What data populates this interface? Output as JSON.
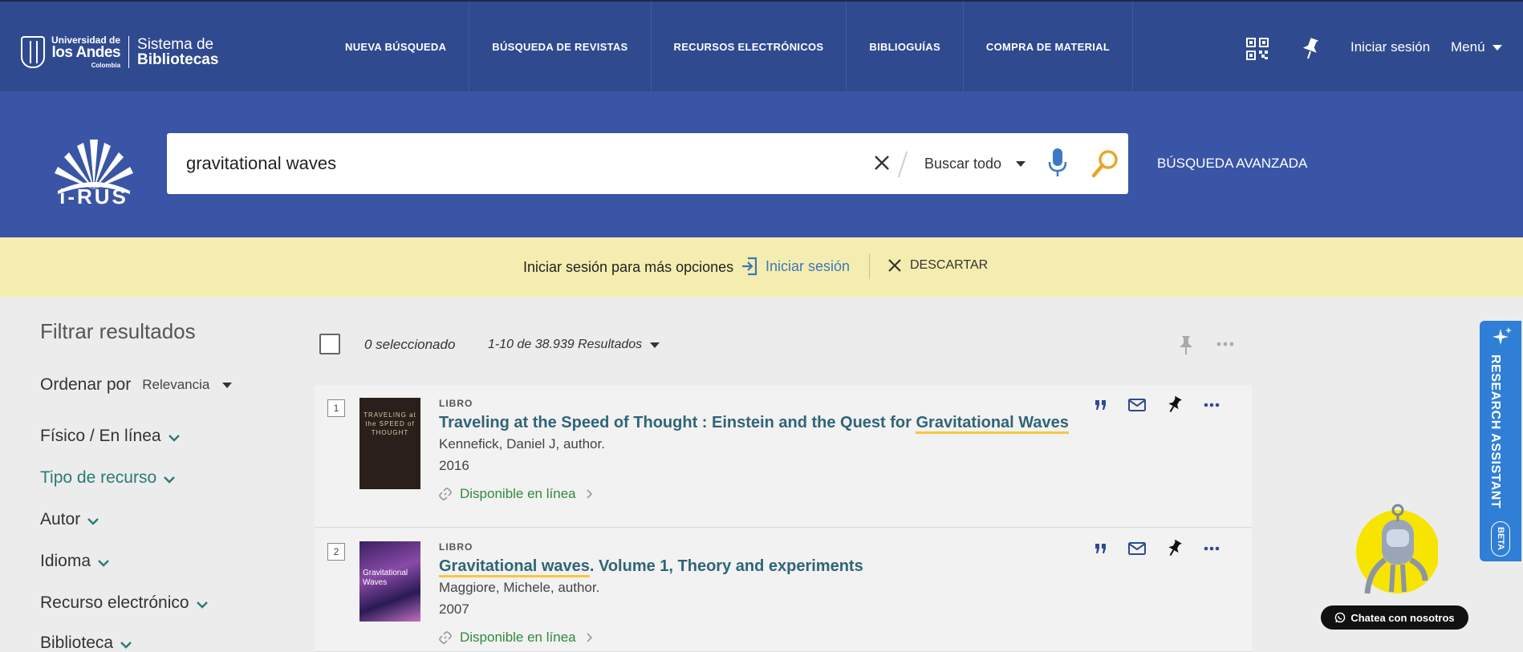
{
  "header": {
    "university": {
      "line1": "Universidad de",
      "line2": "los Andes",
      "line3": "Colombia"
    },
    "system": {
      "line1": "Sistema de",
      "line2": "Bibliotecas"
    },
    "nav": [
      {
        "label": "NUEVA BÚSQUEDA"
      },
      {
        "label": "BÚSQUEDA DE REVISTAS"
      },
      {
        "label": "RECURSOS ELECTRÓNICOS"
      },
      {
        "label": "BIBLIOGUÍAS"
      },
      {
        "label": "COMPRA DE MATERIAL"
      }
    ],
    "login_label": "Iniciar sesión",
    "menu_label": "Menú",
    "icons": [
      "qr-code-icon",
      "pin-icon"
    ]
  },
  "search": {
    "logo_text": "i-RUS",
    "query": "gravitational waves",
    "scope": "Buscar todo",
    "advanced_label": "BÚSQUEDA AVANZADA"
  },
  "notice": {
    "text": "Iniciar sesión para más opciones",
    "login_label": "Iniciar sesión",
    "dismiss_label": "DESCARTAR"
  },
  "facets": {
    "title": "Filtrar resultados",
    "sort_label": "Ordenar por",
    "sort_value": "Relevancia",
    "items": [
      {
        "label": "Físico / En línea"
      },
      {
        "label": "Tipo de recurso"
      },
      {
        "label": "Autor"
      },
      {
        "label": "Idioma"
      },
      {
        "label": "Recurso electrónico"
      },
      {
        "label": "Biblioteca"
      }
    ]
  },
  "results": {
    "selected": "0 seleccionado",
    "count": "1-10 de 38.939 Resultados",
    "items": [
      {
        "number": "1",
        "type": "LIBRO",
        "title_pre": "Traveling at the Speed of Thought : Einstein and the Quest for ",
        "title_hl": "Gravitational Waves",
        "title_post": "",
        "author": "Kennefick, Daniel J, author.",
        "year": "2016",
        "availability": "Disponible en línea",
        "cover_text": "TRAVELING at the SPEED of THOUGHT"
      },
      {
        "number": "2",
        "type": "LIBRO",
        "title_pre": "",
        "title_hl": "Gravitational waves",
        "title_post": ". Volume 1, Theory and experiments",
        "author": "Maggiore, Michele, author.",
        "year": "2007",
        "availability": "Disponible en línea",
        "cover_text": "Gravitational Waves"
      }
    ]
  },
  "assistant": {
    "label": "RESEARCH ASSISTANT",
    "badge": "BETA",
    "chat_label": "Chatea con nosotros"
  },
  "colors": {
    "topbar": "#2f4a8f",
    "searchband": "#3a55a6",
    "notice": "#f5edb0",
    "title_link": "#2f6577",
    "available": "#2e8b3a",
    "highlight": "#f5c842",
    "assistant_tab": "#2f7fd6"
  }
}
